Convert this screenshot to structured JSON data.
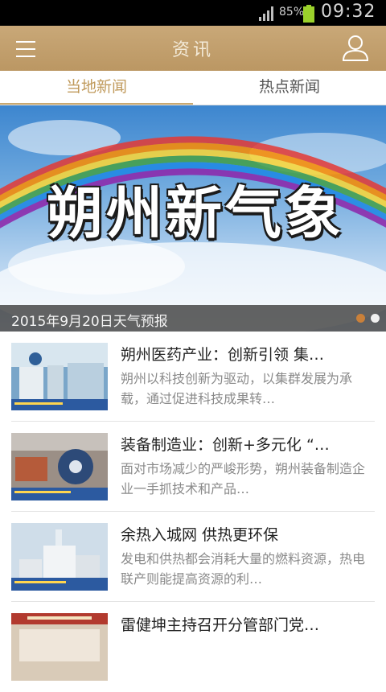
{
  "status_bar": {
    "battery_percent": "85%",
    "time": "09:32"
  },
  "app_bar": {
    "title": "资讯"
  },
  "tabs": [
    {
      "label": "当地新闻",
      "active": true
    },
    {
      "label": "热点新闻",
      "active": false
    }
  ],
  "banner": {
    "image_title": "朔州新气象",
    "caption": "2015年9月20日天气预报",
    "slide_count": 2,
    "active_slide": 1
  },
  "news": [
    {
      "title": "朔州医药产业：创新引领 集…",
      "summary": "朔州以科技创新为驱动，以集群发展为承载，通过促进科技成果转…"
    },
    {
      "title": "装备制造业：创新+多元化 “…",
      "summary": "面对市场减少的严峻形势，朔州装备制造企业一手抓技术和产品…"
    },
    {
      "title": "余热入城网 供热更环保",
      "summary": "发电和供热都会消耗大量的燃料资源，热电联产则能提高资源的利…"
    },
    {
      "title": "雷健坤主持召开分管部门党…",
      "summary": ""
    }
  ],
  "colors": {
    "accent": "#c09a5c",
    "app_bar": "#c4a170",
    "active_dot": "#c9803a"
  }
}
